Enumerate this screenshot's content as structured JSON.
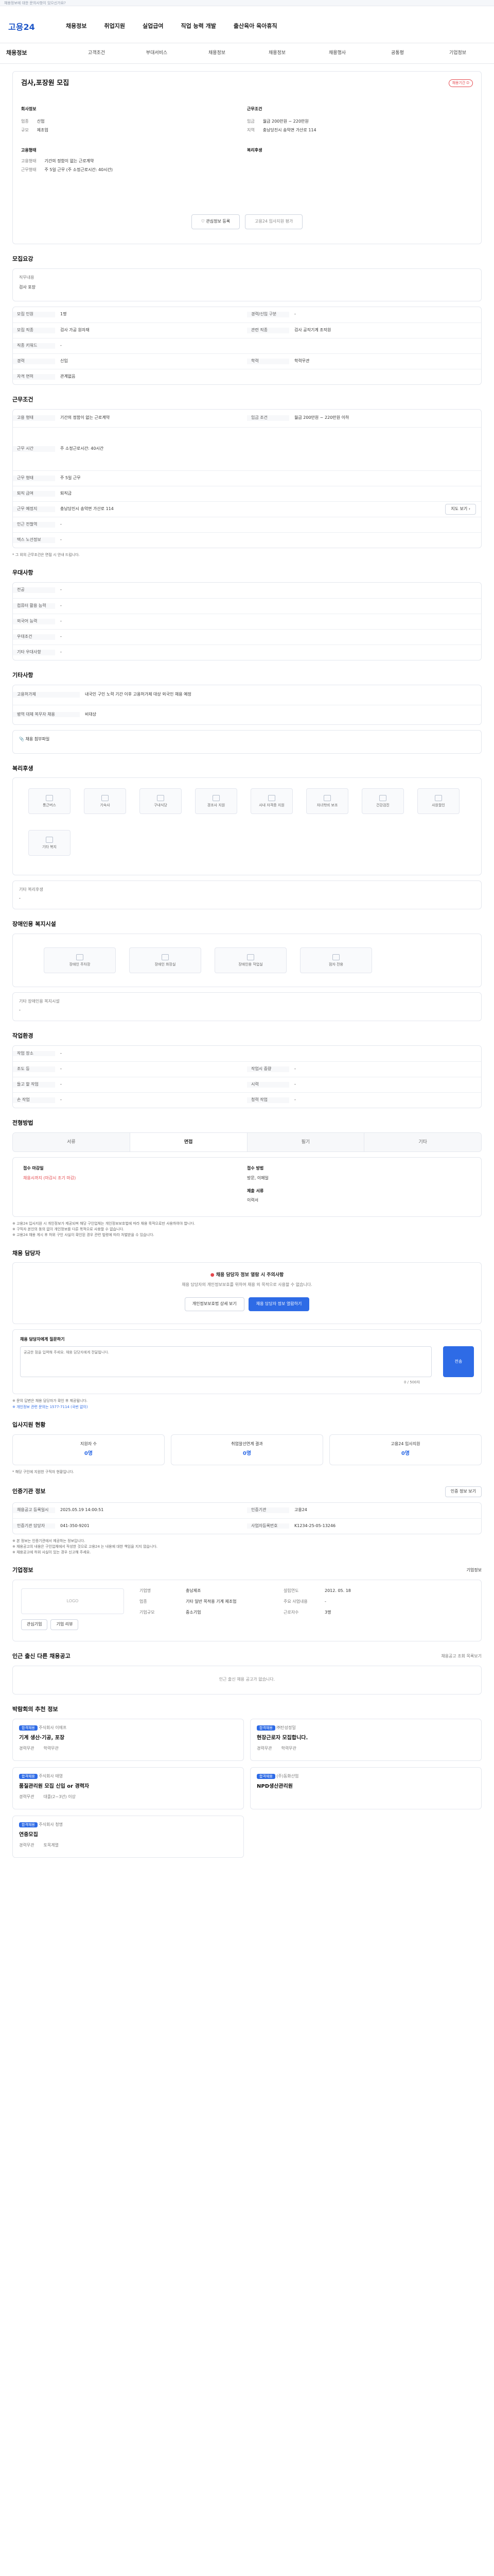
{
  "topbar": {
    "text": "채용정보에 대한 문의사항이 있으신가요?"
  },
  "header": {
    "logo": "고용24",
    "nav": [
      "채용정보",
      "취업지원",
      "실업급여",
      "직업 능력 개발",
      "출산육아 육아휴직"
    ]
  },
  "subnav": [
    "채용정보",
    "고객조건",
    "부대서비스",
    "채용정보",
    "채용정보",
    "채용행사",
    "공통평",
    "기업정보"
  ],
  "job": {
    "title": "검사,포장원 모집",
    "badge": "채용기간 D",
    "left_labels": [
      "회사정보",
      "업종",
      "규모"
    ],
    "left_values": [
      "신업",
      "제조업"
    ],
    "right_labels": [
      "근무조건",
      "임금",
      "지역"
    ],
    "right_values": [
      "월급 200만원 ~ 220만원",
      "충남당진시 송악면 가산로 114"
    ],
    "req_heading": "고용형태",
    "req_rows": [
      [
        "고용형태",
        "기간의 정함이 없는 근로계약"
      ],
      [
        "근무형태",
        "주 5일 근무 (주 소정근로시간: 40시간)"
      ]
    ],
    "salary_heading": "복리후생",
    "btn_interest": "관심정보 등록",
    "btn_similar": "고용24 입사지원 평가"
  },
  "recruit": {
    "heading": "모집요강",
    "duty_label": "직무내용",
    "duty_value": "검사 포장",
    "rows": [
      [
        "모집 인원",
        "1명",
        "경력/신입 구분",
        "-"
      ],
      [
        "모집 직종",
        "검사 가공 원자재",
        "관련 직종",
        "검사 공작기계 조작원"
      ],
      [
        "직종 키워드",
        "-",
        "",
        ""
      ],
      [
        "경력",
        "신입",
        "학력",
        "학력무관"
      ],
      [
        "자격 면허",
        "관계없음",
        "",
        ""
      ]
    ]
  },
  "workcond": {
    "heading": "근무조건",
    "rows": [
      [
        "고용 형태",
        "기간의 정함이 없는 근로계약",
        "임금 조건",
        "월급 200만원 ~ 220만원 이하"
      ],
      [
        "근무 시간",
        "주 소정근로시간: 40시간",
        "",
        ""
      ],
      [
        "근무 형태",
        "주 5일 근무",
        "",
        ""
      ],
      [
        "퇴직 급여",
        "퇴직금",
        "",
        ""
      ],
      [
        "근무 예정지",
        "충남당진시 송악면 가산로 114",
        "",
        ""
      ],
      [
        "인근 전철역",
        "-",
        "",
        ""
      ],
      [
        "택스 노선정보",
        "-",
        "",
        ""
      ]
    ],
    "note": "* 그 외의 근무조건은 면접 시 안내 드립니다."
  },
  "prefer": {
    "heading": "우대사항",
    "rows": [
      [
        "전공",
        "-"
      ],
      [
        "컴퓨터 활용 능력",
        "-"
      ],
      [
        "외국어 능력",
        "-"
      ],
      [
        "우대조건",
        "-"
      ],
      [
        "기타 우대사항",
        "-"
      ]
    ]
  },
  "etc": {
    "heading": "기타사항",
    "rows": [
      [
        "고용허가제",
        "내국인 구인 노력 기간 이후 고용허가제 대상 외국인 채용 예정"
      ],
      [
        "병역 대체 복무자 채용",
        "비대상"
      ]
    ],
    "file": "채용 첨부파일"
  },
  "welfare": {
    "heading": "복리후생",
    "tiles": [
      "통근버스",
      "기숙사",
      "구내식당",
      "경조사 지원",
      "사내 자격증 지원",
      "자녀학비 보조",
      "건강검진",
      "사원할인",
      "기타 복지"
    ],
    "extra_label": "기타 복리후생",
    "extra_value": "-"
  },
  "disabled": {
    "heading": "장애인용 복지시설",
    "tiles": [
      "장애인 주차장",
      "장애인 화장실",
      "장애인용 작업실",
      "점자 전용"
    ],
    "extra_label": "기타 장애인용 복지시설",
    "extra_value": "-"
  },
  "env": {
    "heading": "작업환경",
    "rows": [
      [
        "작업 장소",
        "-",
        "",
        ""
      ],
      [
        "조도 등",
        "-",
        "작업시 중량",
        "-"
      ],
      [
        "들고 할 작업",
        "-",
        "시력",
        "-"
      ],
      [
        "손 작업",
        "-",
        "청력 작업",
        "-"
      ]
    ]
  },
  "method": {
    "heading": "전형방법",
    "tabs": [
      "서류",
      "면접",
      "필기",
      "기타"
    ],
    "left_label": "접수 마감일",
    "left_value": "채용시까지 (마감시 조기 마감)",
    "right_label": "접수 방법",
    "right_value": "방문, 이메일",
    "doc_label": "제출 서류",
    "doc_value": "이력서",
    "notes": [
      "※ 고용24 입사지원 시 개인정보가 제공되며 해당 구인업체는 개인정보보호법에 따라 채용 목적으로만 사용하여야 합니다.",
      "※ 구직자 본인의 동의 없이 개인정보를 다른 목적으로 사용할 수 없습니다.",
      "※ 고용24 채용 게시 후 허위 구인 사실이 확인된 경우 관련 법령에 따라 처벌받을 수 있습니다."
    ]
  },
  "contact": {
    "heading": "채용 담당자",
    "warn": "채용 담당자 정보 열람 시 주의사항",
    "warn_text": "채용 담당자의 개인정보보호를 위하여 채용 외 목적으로 사용할 수 없습니다.",
    "btn_a": "개인정보보호법 상세 보기",
    "btn_b": "채용 담당자 정보 열람하기",
    "ask_label": "채용 담당자에게 질문하기",
    "ask_placeholder": "궁금한 점을 입력해 주세요. 채용 담당자에게 전달됩니다.",
    "ask_count": "0 / 500자",
    "ask_button": "전송",
    "ask_notes": [
      "※ 문의 답변은 채용 담당자가 확인 후 제공됩니다.",
      "※ 개인정보 관련 문의는 1577-7114 (국번 없이)"
    ]
  },
  "stats": {
    "heading": "입사지원 현황",
    "items": [
      [
        "지원자 수",
        "0명"
      ],
      [
        "취업알선연계 결과",
        "0명"
      ],
      [
        "고용24 입사지원",
        "0명"
      ]
    ],
    "note": "* 해당 구인에 지원한 구직자 현황입니다."
  },
  "info": {
    "heading": "인증기관 정보",
    "btn": "인증 정보 보기",
    "rows": [
      [
        "채용공고 등록일시",
        "2025.05.19 14:00:51",
        "인증기관",
        "고용24"
      ],
      [
        "인증기관 담당자",
        "041-350-9201",
        "사업자등록번호",
        "K1234-25-05-13246"
      ]
    ],
    "notes": [
      "※ 본 정보는 인증기관에서 제공하는 정보입니다.",
      "※ 채용공고의 내용은 구인업체에서 작성한 것으로 고용24 는 내용에 대한 책임을 지지 않습니다.",
      "※ 채용공고에 허위 사실이 있는 경우 신고해 주세요."
    ]
  },
  "company": {
    "heading": "기업정보",
    "more": "기업정보",
    "logo": "LOGO",
    "btns": [
      "관심기업",
      "기업 리뷰"
    ],
    "rows": [
      [
        "기업명",
        "충남제조",
        "설립연도",
        "2012. 05. 18"
      ],
      [
        "업종",
        "기타 일반 목적용 기계 제조업",
        "주요 사업내용",
        "-"
      ],
      [
        "기업규모",
        "중소기업",
        "근로자수",
        "3명"
      ]
    ]
  },
  "related": {
    "heading": "인근 출신 다른 채용공고",
    "sub": "채용공고 조회 목록보기",
    "empty": "인근 출신 채용 공고가 없습니다."
  },
  "recommend": {
    "heading": "박람회의 추천 정보",
    "items": [
      [
        "합격채용",
        "주식회사 이에프",
        "기계 생산·기공, 포장",
        "경력무관",
        "학력무관"
      ],
      [
        "합격채용",
        "㈜탄성정밀",
        "현장근로자 모집합니다.",
        "경력무관",
        "학력무관"
      ],
      [
        "합격채용",
        "주식회사 태영",
        "품질관리원 모집 신입 or 경력자",
        "경력무관",
        "대졸(2~3년) 이상"
      ],
      [
        "합격채용",
        "(주)동화산업",
        "NPD생산관리원",
        "",
        ""
      ],
      [
        "합격채용",
        "주식회사 청명",
        "연중모집",
        "경력무관",
        "토목계열"
      ]
    ]
  }
}
